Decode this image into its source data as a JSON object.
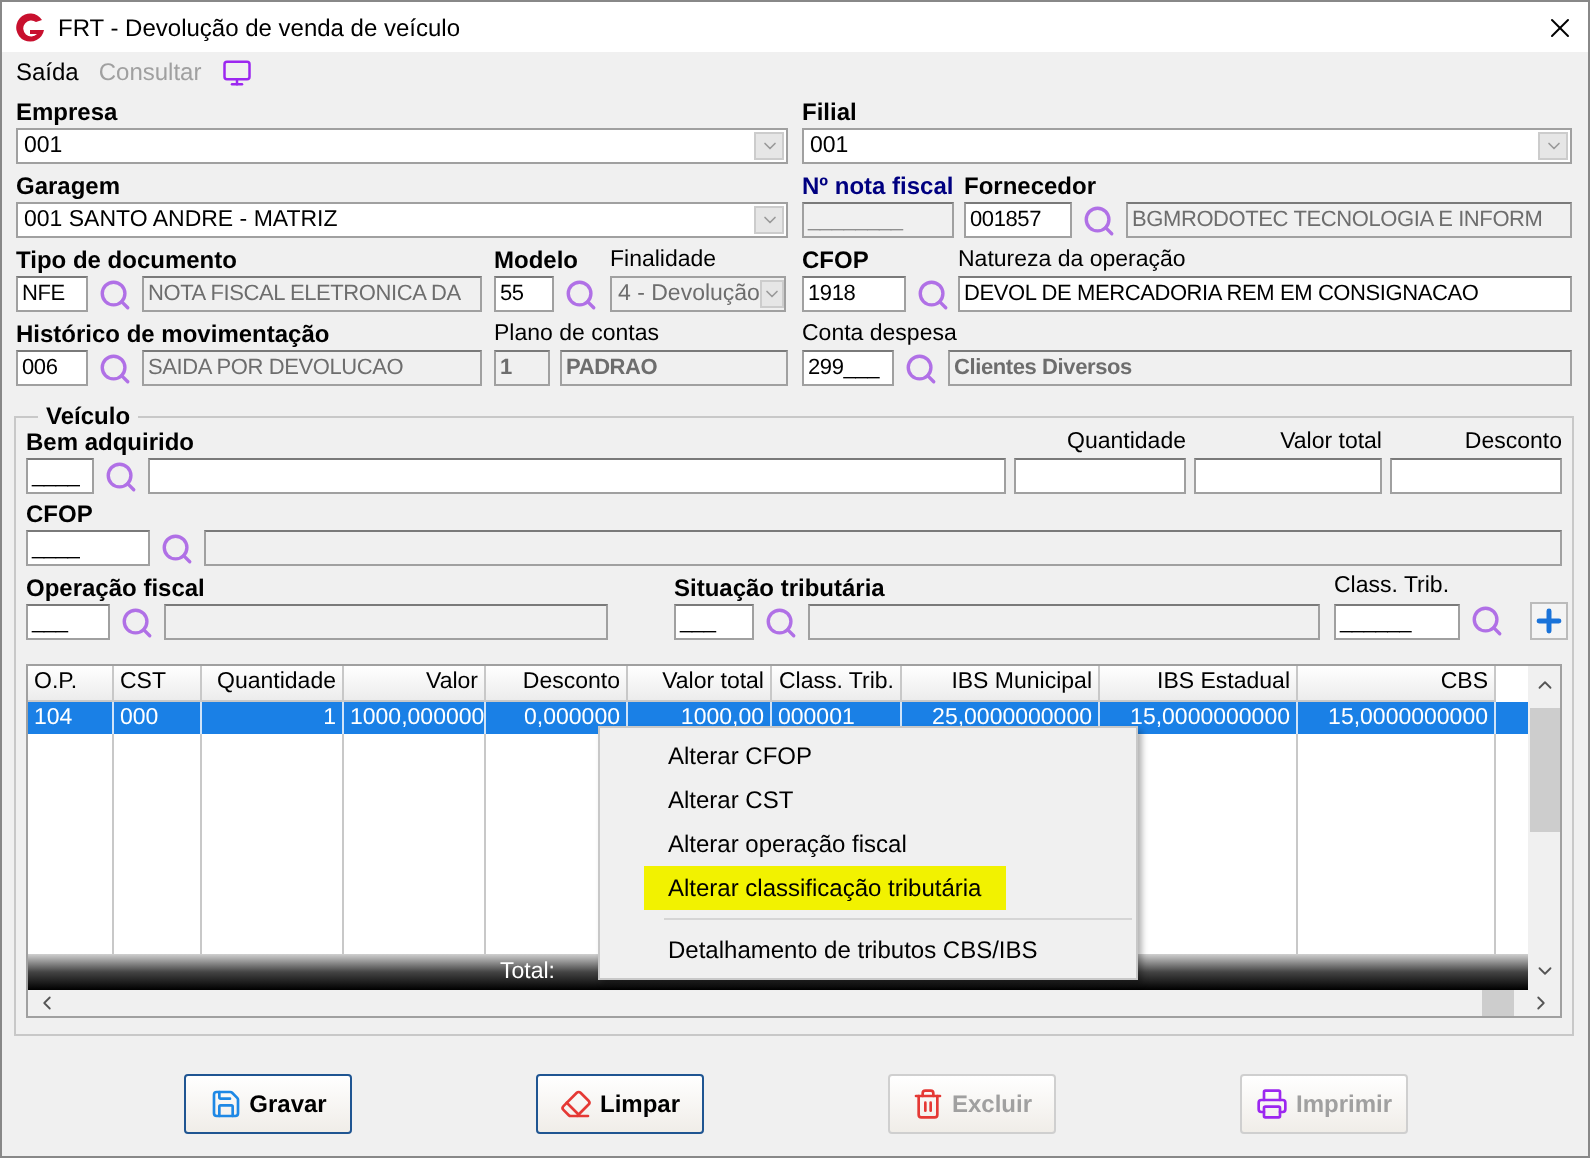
{
  "window": {
    "title": "FRT - Devolução de venda de veículo"
  },
  "menu": [
    {
      "label": "Saída",
      "disabled": false
    },
    {
      "label": "Consultar",
      "disabled": true
    }
  ],
  "header": {
    "empresa": {
      "label": "Empresa",
      "value": "001"
    },
    "filial": {
      "label": "Filial",
      "value": "001"
    },
    "garagem": {
      "label": "Garagem",
      "value": "001 SANTO ANDRE - MATRIZ"
    },
    "nota_fiscal": {
      "label": "Nº nota fiscal",
      "placeholder": "________",
      "disabled": true
    },
    "fornecedor": {
      "label": "Fornecedor",
      "code": "001857",
      "name": "BGMRODOTEC TECNOLOGIA E INFORM"
    },
    "tipo_documento": {
      "label": "Tipo de documento",
      "code": "NFE",
      "name": "NOTA FISCAL ELETRONICA DA"
    },
    "modelo": {
      "label": "Modelo",
      "value": "55"
    },
    "finalidade": {
      "label": "Finalidade",
      "value": "4 - Devolução",
      "disabled": true
    },
    "cfop": {
      "label": "CFOP",
      "code": "1918"
    },
    "natureza": {
      "label": "Natureza da operação",
      "value": "DEVOL DE MERCADORIA REM EM CONSIGNACAO"
    },
    "historico": {
      "label": "Histórico de movimentação",
      "code": "006",
      "name": "SAIDA POR DEVOLUCAO"
    },
    "plano_contas": {
      "label": "Plano de contas",
      "code": "1",
      "name": "PADRAO"
    },
    "conta_despesa": {
      "label": "Conta despesa",
      "code": "299___",
      "name": "Clientes Diversos"
    }
  },
  "vehicle": {
    "title": "Veículo",
    "bem": {
      "label": "Bem adquirido",
      "code": "____"
    },
    "quantidade": {
      "label": "Quantidade"
    },
    "valor_total": {
      "label": "Valor total"
    },
    "desconto": {
      "label": "Desconto"
    },
    "cfop": {
      "label": "CFOP",
      "code": "____"
    },
    "operacao": {
      "label": "Operação fiscal",
      "code": "___"
    },
    "situacao": {
      "label": "Situação tributária",
      "code": "___"
    },
    "class_trib": {
      "label": "Class. Trib.",
      "code": "______"
    }
  },
  "table": {
    "columns": [
      "O.P.",
      "CST",
      "Quantidade",
      "Valor",
      "Desconto",
      "Valor total",
      "Class. Trib.",
      "IBS Municipal",
      "IBS Estadual",
      "CBS"
    ],
    "rows": [
      {
        "selected": true,
        "cells": [
          "104",
          "000",
          "1",
          "1000,000000",
          "0,000000",
          "1000,00",
          "000001",
          "25,0000000000",
          "15,0000000000",
          "15,0000000000"
        ]
      }
    ],
    "totals_label": "Total:"
  },
  "context_menu": [
    {
      "kind": "item",
      "label": "Alterar CFOP",
      "highlighted": false
    },
    {
      "kind": "item",
      "label": "Alterar CST",
      "highlighted": false
    },
    {
      "kind": "item",
      "label": "Alterar operação fiscal",
      "highlighted": false
    },
    {
      "kind": "item",
      "label": "Alterar classificação tributária",
      "highlighted": true
    },
    {
      "kind": "separator"
    },
    {
      "kind": "item",
      "label": "Detalhamento de tributos CBS/IBS",
      "highlighted": false
    }
  ],
  "buttons": [
    {
      "label": "Gravar",
      "disabled": false
    },
    {
      "label": "Limpar",
      "disabled": false
    },
    {
      "label": "Excluir",
      "disabled": true
    },
    {
      "label": "Imprimir",
      "disabled": true
    }
  ]
}
